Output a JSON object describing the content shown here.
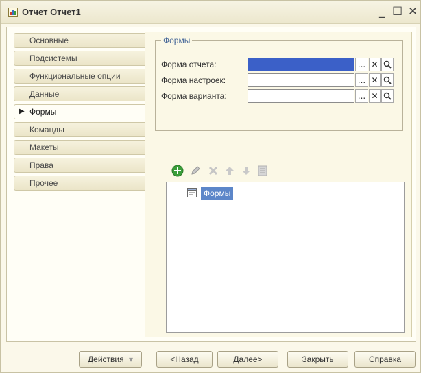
{
  "window": {
    "title": "Отчет Отчет1",
    "minimize_glyph": "_",
    "maximize_glyph": "☐",
    "close_glyph": "✕",
    "icon": "report-icon"
  },
  "tabs": [
    {
      "label": "Основные",
      "active": false
    },
    {
      "label": "Подсистемы",
      "active": false
    },
    {
      "label": "Функциональные опции",
      "active": false
    },
    {
      "label": "Данные",
      "active": false
    },
    {
      "label": "Формы",
      "active": true
    },
    {
      "label": "Команды",
      "active": false
    },
    {
      "label": "Макеты",
      "active": false
    },
    {
      "label": "Права",
      "active": false
    },
    {
      "label": "Прочее",
      "active": false
    }
  ],
  "forms_group": {
    "legend": "Формы",
    "fields": [
      {
        "label": "Форма отчета:",
        "value": "",
        "selected": true
      },
      {
        "label": "Форма настроек:",
        "value": "",
        "selected": false
      },
      {
        "label": "Форма варианта:",
        "value": "",
        "selected": false
      }
    ],
    "select_glyph": "...",
    "clear_glyph": "✕",
    "open_glyph": "🔍"
  },
  "toolbar": [
    "add-icon",
    "edit-icon",
    "delete-icon",
    "move-up-icon",
    "move-down-icon",
    "list-icon"
  ],
  "tree": {
    "items": [
      {
        "label": "Формы",
        "icon": "form-icon"
      }
    ]
  },
  "bottom_buttons": {
    "actions": "Действия",
    "actions_arrow": "▾",
    "back": "<Назад",
    "next": "Далее>",
    "close": "Закрыть",
    "help": "Справка"
  },
  "colors": {
    "window_bg": "#fbf8ea",
    "selection": "#3b60c8",
    "tree_selection": "#5c86c9",
    "legend_text": "#4a6a9a"
  }
}
